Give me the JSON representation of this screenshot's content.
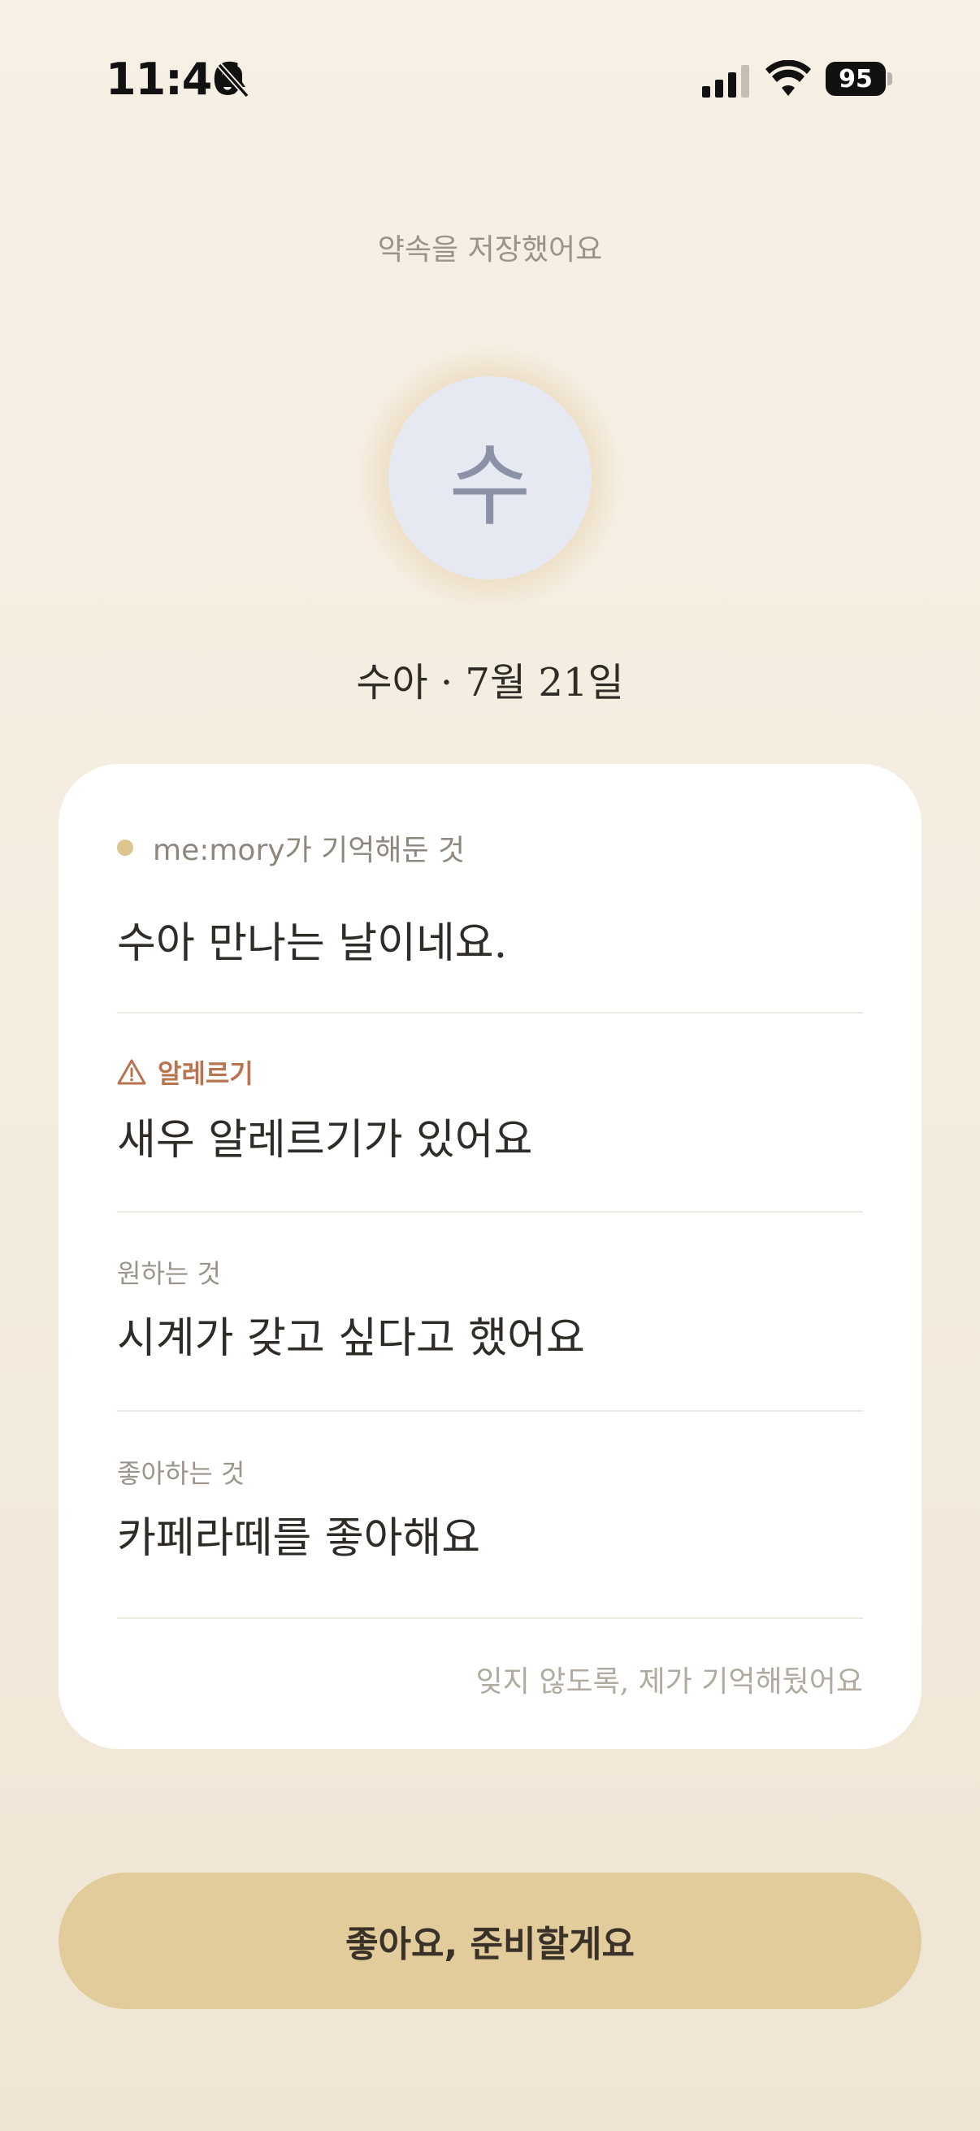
{
  "status_bar": {
    "time": "11:46",
    "battery": "95"
  },
  "header": {
    "title": "약속을 저장했어요"
  },
  "person": {
    "avatar_initial": "수",
    "line": "수아 · 7월 21일"
  },
  "card": {
    "header": "me:mory가 기억해둔 것",
    "intro": "수아 만나는 날이네요.",
    "sections": [
      {
        "label": "알레르기",
        "value": "새우 알레르기가 있어요"
      },
      {
        "label": "원하는 것",
        "value": "시계가 갖고 싶다고 했어요"
      },
      {
        "label": "좋아하는 것",
        "value": "카페라떼를 좋아해요"
      }
    ],
    "footer": "잊지 않도록, 제가 기억해뒀어요"
  },
  "cta": {
    "label": "좋아요, 준비할게요"
  },
  "colors": {
    "accent": "#e2cc9b",
    "allergy": "#b7744e",
    "avatar_bg": "#e6e8f2"
  },
  "icons": [
    "bell-slash-icon",
    "cellular-signal-icon",
    "wifi-icon",
    "battery-icon",
    "warning-triangle-icon"
  ]
}
